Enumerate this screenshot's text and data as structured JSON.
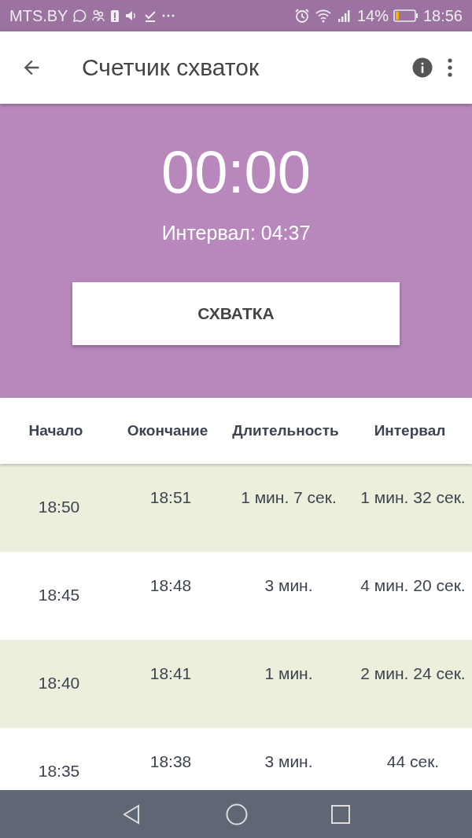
{
  "status_bar": {
    "carrier": "MTS.BY",
    "battery_percent": "14%",
    "time": "18:56"
  },
  "app_bar": {
    "title": "Счетчик схваток"
  },
  "timer": {
    "elapsed": "00:00",
    "interval": "Интервал: 04:37",
    "button": "СХВАТКА"
  },
  "table": {
    "columns": [
      "Начало",
      "Окончание",
      "Длительность",
      "Интервал"
    ],
    "rows": [
      {
        "start": "18:50",
        "end": "18:51",
        "duration": "1 мин. 7 сек.",
        "interval": "1 мин. 32 сек."
      },
      {
        "start": "18:45",
        "end": "18:48",
        "duration": "3 мин.",
        "interval": "4 мин. 20 сек."
      },
      {
        "start": "18:40",
        "end": "18:41",
        "duration": "1 мин.",
        "interval": "2 мин. 24 сек."
      },
      {
        "start": "18:35",
        "end": "18:38",
        "duration": "3 мин.",
        "interval": "44 сек."
      }
    ]
  }
}
